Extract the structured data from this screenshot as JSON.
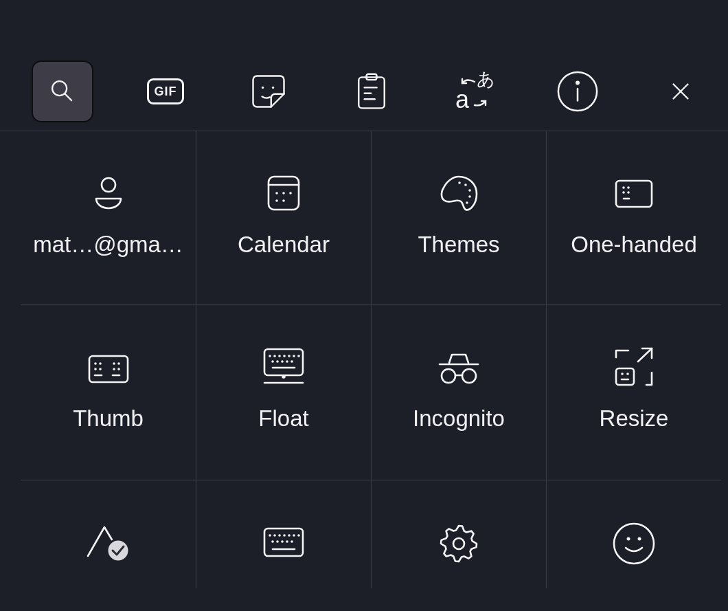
{
  "toolbar": [
    {
      "kind": "search",
      "selected": true
    },
    {
      "kind": "gif",
      "label": "GIF",
      "selected": false
    },
    {
      "kind": "sticker",
      "selected": false
    },
    {
      "kind": "clipboard",
      "selected": false
    },
    {
      "kind": "translate",
      "source": "a",
      "target": "あ",
      "selected": false
    },
    {
      "kind": "info",
      "selected": false
    },
    {
      "kind": "close",
      "selected": false
    }
  ],
  "grid": [
    {
      "kind": "account",
      "label": "mat…@gma…"
    },
    {
      "kind": "calendar",
      "label": "Calendar"
    },
    {
      "kind": "themes",
      "label": "Themes"
    },
    {
      "kind": "one-handed",
      "label": "One-handed"
    },
    {
      "kind": "thumb",
      "label": "Thumb"
    },
    {
      "kind": "float",
      "label": "Float"
    },
    {
      "kind": "incognito",
      "label": "Incognito"
    },
    {
      "kind": "resize",
      "label": "Resize"
    },
    {
      "kind": "handwriting"
    },
    {
      "kind": "keyboard"
    },
    {
      "kind": "settings"
    },
    {
      "kind": "emoji"
    }
  ]
}
